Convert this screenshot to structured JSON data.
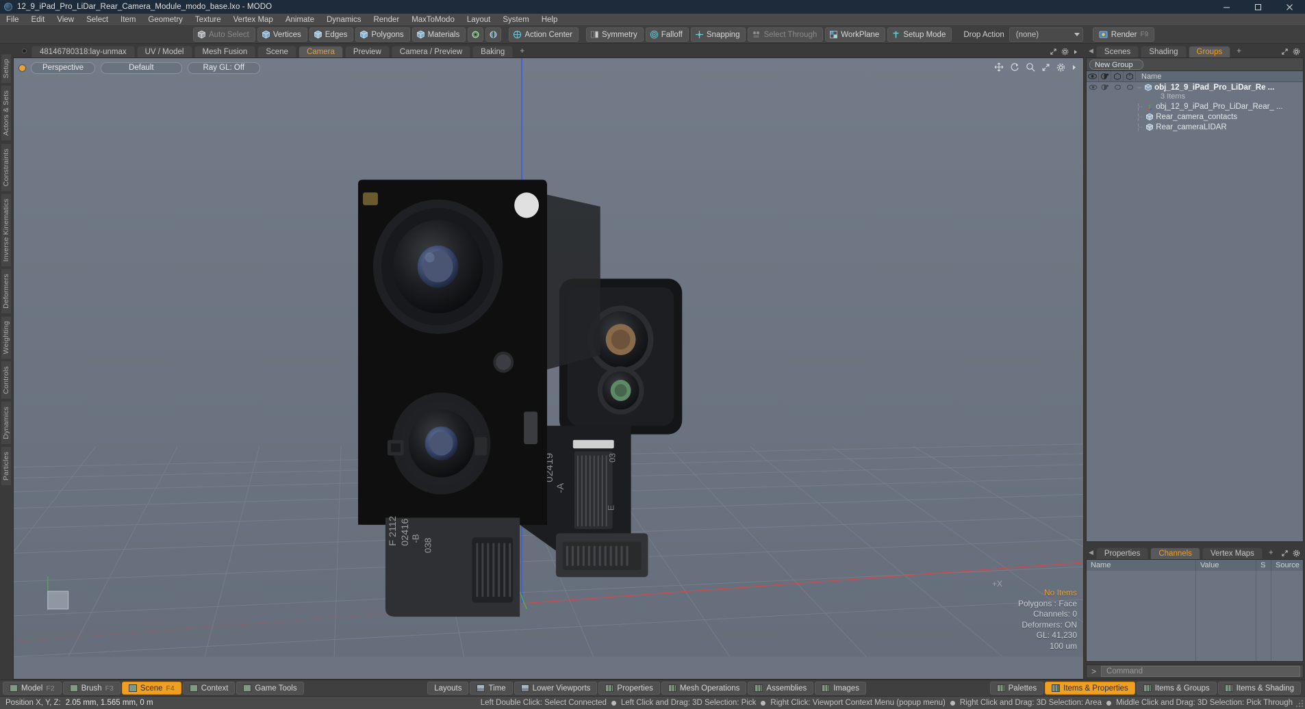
{
  "window": {
    "title": "12_9_iPad_Pro_LiDar_Rear_Camera_Module_modo_base.lxo - MODO",
    "app_logo": "modo-logo",
    "minimize": "minimize-icon",
    "maximize": "maximize-icon",
    "close": "close-icon"
  },
  "menubar": {
    "items": [
      {
        "label": "File"
      },
      {
        "label": "Edit"
      },
      {
        "label": "View"
      },
      {
        "label": "Select"
      },
      {
        "label": "Item"
      },
      {
        "label": "Geometry"
      },
      {
        "label": "Texture"
      },
      {
        "label": "Vertex Map"
      },
      {
        "label": "Animate"
      },
      {
        "label": "Dynamics"
      },
      {
        "label": "Render"
      },
      {
        "label": "MaxToModo"
      },
      {
        "label": "Layout"
      },
      {
        "label": "System"
      },
      {
        "label": "Help"
      }
    ]
  },
  "toolbar": {
    "buttons": [
      {
        "label": "Auto Select",
        "icon": "cube-grey-icon",
        "dim": true
      },
      {
        "label": "Vertices",
        "icon": "cube-vertices-icon",
        "dim": false
      },
      {
        "label": "Edges",
        "icon": "cube-edges-icon",
        "dim": false
      },
      {
        "label": "Polygons",
        "icon": "cube-polygons-icon",
        "dim": false
      },
      {
        "label": "Materials",
        "icon": "cube-materials-icon",
        "dim": false
      }
    ],
    "small_icons": [
      "pivot-icon",
      "center-icon"
    ],
    "modes": [
      {
        "label": "Action Center",
        "icon": "action-center-icon",
        "dim": false
      },
      {
        "label": "Symmetry",
        "icon": "symmetry-icon",
        "dim": false
      },
      {
        "label": "Falloff",
        "icon": "falloff-icon",
        "dim": false
      },
      {
        "label": "Snapping",
        "icon": "snapping-icon",
        "dim": false
      },
      {
        "label": "Select Through",
        "icon": "select-through-icon",
        "dim": true
      },
      {
        "label": "WorkPlane",
        "icon": "workplane-icon",
        "dim": false
      },
      {
        "label": "Setup Mode",
        "icon": "setup-mode-icon",
        "dim": false
      }
    ],
    "drop_action_label": "Drop Action",
    "drop_action_value": "(none)",
    "render_label": "Render",
    "render_shortcut": "F9",
    "render_icon": "render-icon"
  },
  "viewport_tabs": {
    "tabs": [
      {
        "label": "48146780318:lay-unmax",
        "active": false
      },
      {
        "label": "UV / Model",
        "active": false
      },
      {
        "label": "Mesh Fusion",
        "active": false
      },
      {
        "label": "Scene",
        "active": false
      },
      {
        "label": "Camera",
        "active": true
      },
      {
        "label": "Preview",
        "active": false
      },
      {
        "label": "Camera / Preview",
        "active": false
      },
      {
        "label": "Baking",
        "active": false
      }
    ],
    "add_label": "+",
    "icons": [
      "expand-icon",
      "gear-icon",
      "chevron-right-icon"
    ]
  },
  "viewport": {
    "view_mode": "Perspective",
    "shading_mode": "Default",
    "raygl": "Ray GL: Off",
    "tool_icons": [
      "move-icon",
      "rotate-icon",
      "zoom-icon",
      "expand-icon",
      "gear-icon",
      "chevron-right-icon"
    ],
    "axis_label": "+X",
    "stats": {
      "selection": "No Items",
      "polygons": "Polygons : Face",
      "channels": "Channels: 0",
      "deformers": "Deformers: ON",
      "gl": "GL: 41,230",
      "scale": "100 um"
    },
    "axis_colors": {
      "x": "#cf4a4a",
      "y": "#4caf50",
      "z": "#3b5bdb"
    },
    "background": "#6b7480"
  },
  "left_rail": {
    "tabs": [
      "Setup",
      "Actors & Sets",
      "Constraints",
      "Inverse Kinematics",
      "Deformers",
      "Weighting",
      "Controls",
      "Dynamics",
      "Particles"
    ]
  },
  "right_panel": {
    "tabs": [
      {
        "label": "Scenes",
        "active": false
      },
      {
        "label": "Shading",
        "active": false
      },
      {
        "label": "Groups",
        "active": true
      }
    ],
    "add_label": "+",
    "icons": [
      "expand-icon",
      "gear-icon"
    ],
    "new_group_button": "New Group",
    "column_headers": {
      "eye": "visibility-icon",
      "shade": "shading-icon",
      "lock1": "render-toggle-icon",
      "lock2": "select-toggle-icon",
      "name": "Name"
    },
    "items": [
      {
        "label": "obj_12_9_iPad_Pro_LiDar_Re ...",
        "icon": "group-icon",
        "depth": 0,
        "bold": true,
        "subtitle": "3 Items"
      },
      {
        "label": "obj_12_9_iPad_Pro_LiDar_Rear_ ...",
        "icon": "locator-icon",
        "depth": 1,
        "bold": false
      },
      {
        "label": "Rear_camera_contacts",
        "icon": "mesh-icon",
        "depth": 1,
        "bold": false
      },
      {
        "label": "Rear_cameraLIDAR",
        "icon": "mesh-icon",
        "depth": 1,
        "bold": false
      }
    ]
  },
  "properties_panel": {
    "tabs": [
      {
        "label": "Properties",
        "active": false
      },
      {
        "label": "Channels",
        "active": true
      },
      {
        "label": "Vertex Maps",
        "active": false
      }
    ],
    "add_label": "+",
    "icons": [
      "expand-icon",
      "gear-icon"
    ],
    "columns": [
      "Name",
      "Value",
      "S",
      "Source"
    ],
    "rows": []
  },
  "command_line": {
    "prompt": ">",
    "placeholder": "Command"
  },
  "bottom_bar": {
    "left_buttons": [
      {
        "label": "Model",
        "fkey": "F2",
        "active": false,
        "icon": "model-icon"
      },
      {
        "label": "Brush",
        "fkey": "F3",
        "active": false,
        "icon": "brush-icon"
      },
      {
        "label": "Scene",
        "fkey": "F4",
        "active": true,
        "icon": "scene-icon"
      },
      {
        "label": "Context",
        "fkey": "",
        "active": false,
        "icon": "context-icon"
      },
      {
        "label": "Game Tools",
        "fkey": "",
        "active": false,
        "icon": "gametools-icon"
      }
    ],
    "center_buttons": [
      {
        "label": "Layouts",
        "icon": ""
      },
      {
        "label": "Time",
        "icon": "time-icon"
      },
      {
        "label": "Lower Viewports",
        "icon": "viewport-icon"
      },
      {
        "label": "Properties",
        "icon": "properties-icon"
      },
      {
        "label": "Mesh Operations",
        "icon": "meshops-icon"
      },
      {
        "label": "Assemblies",
        "icon": "assemblies-icon"
      },
      {
        "label": "Images",
        "icon": "images-icon"
      }
    ],
    "right_buttons": [
      {
        "label": "Palettes",
        "icon": "palettes-icon",
        "active": false
      },
      {
        "label": "Items & Properties",
        "icon": "items-props-icon",
        "active": true
      },
      {
        "label": "Items & Groups",
        "icon": "items-groups-icon",
        "active": false
      },
      {
        "label": "Items & Shading",
        "icon": "items-shading-icon",
        "active": false
      }
    ]
  },
  "status_bar": {
    "position_label": "Position X, Y, Z:",
    "position_value": "2.05 mm, 1.565 mm, 0 m",
    "hints": [
      "Left Double Click: Select Connected",
      "Left Click and Drag: 3D Selection: Pick",
      "Right Click: Viewport Context Menu (popup menu)",
      "Right Click and Drag: 3D Selection: Area",
      "Middle Click and Drag: 3D Selection: Pick Through"
    ]
  },
  "model_labels": {
    "left_module": [
      "F 2112",
      "02416",
      "-B",
      "038"
    ],
    "right_module": [
      "02419",
      "-A",
      "E",
      "03"
    ]
  }
}
